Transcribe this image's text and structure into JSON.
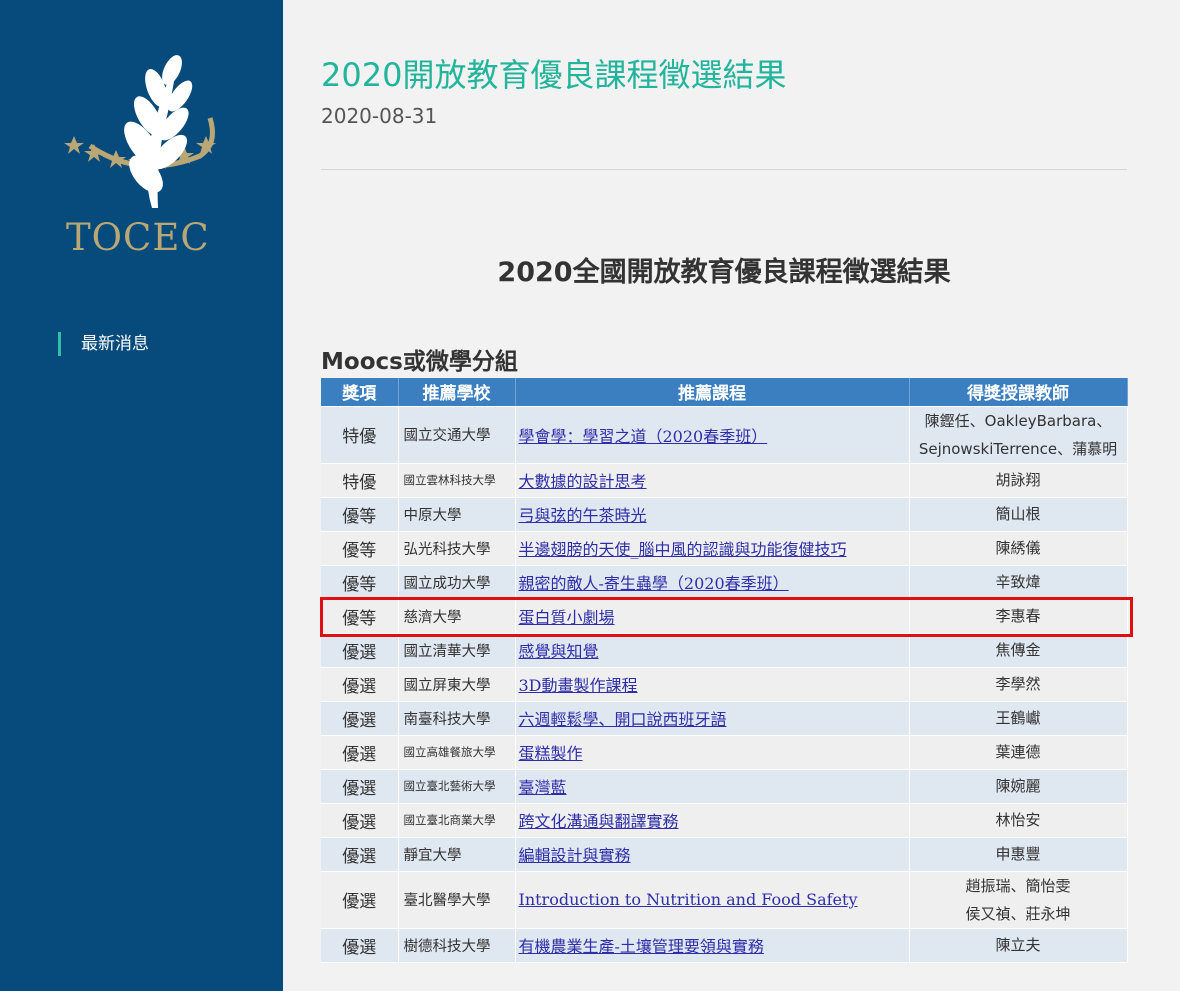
{
  "sidebar": {
    "logo_text": "TOCEC",
    "nav_items": [
      {
        "label": "最新消息"
      }
    ],
    "colors": {
      "background": "#064b7b",
      "accent": "#2fc0a6",
      "logo_gold": "#b9a776"
    }
  },
  "main": {
    "title": "2020開放教育優良課程徵選結果",
    "date": "2020-08-31",
    "section_title": "2020全國開放教育優良課程徵選結果",
    "group_title": "Moocs或微學分組"
  },
  "table": {
    "headers": [
      "獎項",
      "推薦學校",
      "推薦課程",
      "得獎授課教師"
    ],
    "rows": [
      {
        "award": "特優",
        "award_color": "#cc1d1d",
        "school": "國立交通大學",
        "course": "學會學：學習之道（2020春季班）",
        "teacher_line1": "陳鏗任、OakleyBarbara、",
        "teacher_line2": "SejnowskiTerrence、蒲慕明"
      },
      {
        "award": "特優",
        "award_color": "#cc1d1d",
        "school": "國立雲林科技大學",
        "course": "大數據的設計思考",
        "teacher_line1": "胡詠翔"
      },
      {
        "award": "優等",
        "award_color": "#5a3aa2",
        "school": "中原大學",
        "course": "弓與弦的午茶時光",
        "teacher_line1": "簡山根"
      },
      {
        "award": "優等",
        "award_color": "#5a3aa2",
        "school": "弘光科技大學",
        "course": "半邊翅膀的天使_腦中風的認識與功能復健技巧",
        "teacher_line1": "陳綉儀"
      },
      {
        "award": "優等",
        "award_color": "#5a3aa2",
        "school": "國立成功大學",
        "course": "親密的敵人-寄生蟲學（2020春季班）",
        "teacher_line1": "辛致煒"
      },
      {
        "award": "優等",
        "award_color": "#5a3aa2",
        "school": "慈濟大學",
        "course": "蛋白質小劇場",
        "teacher_line1": "李惠春"
      },
      {
        "award": "優選",
        "award_color": "#a0781f",
        "school": "國立清華大學",
        "course": "感覺與知覺",
        "teacher_line1": "焦傳金"
      },
      {
        "award": "優選",
        "award_color": "#a0781f",
        "school": "國立屏東大學",
        "course": "3D動畫製作課程",
        "teacher_line1": "李學然"
      },
      {
        "award": "優選",
        "award_color": "#a0781f",
        "school": "南臺科技大學",
        "course": "六週輕鬆學、開口說西班牙語",
        "teacher_line1": "王鶴巘"
      },
      {
        "award": "優選",
        "award_color": "#a0781f",
        "school": "國立高雄餐旅大學",
        "course": "蛋糕製作",
        "teacher_line1": "葉連德"
      },
      {
        "award": "優選",
        "award_color": "#a0781f",
        "school": "國立臺北藝術大學",
        "course": "臺灣藍",
        "teacher_line1": "陳婉麗"
      },
      {
        "award": "優選",
        "award_color": "#a0781f",
        "school": "國立臺北商業大學",
        "course": "跨文化溝通與翻譯實務",
        "teacher_line1": "林怡安"
      },
      {
        "award": "優選",
        "award_color": "#a0781f",
        "school": "靜宜大學",
        "course": "編輯設計與實務",
        "teacher_line1": "申惠豐"
      },
      {
        "award": "優選",
        "award_color": "#a0781f",
        "school": "臺北醫學大學",
        "course": "Introduction to Nutrition and Food Safety",
        "teacher_line1": "趙振瑞、簡怡雯",
        "teacher_line2": "侯又禎、莊永坤"
      },
      {
        "award": "優選",
        "award_color": "#a0781f",
        "school": "樹德科技大學",
        "course": "有機農業生產-土壤管理要領與實務",
        "teacher_line1": "陳立夫"
      }
    ]
  }
}
